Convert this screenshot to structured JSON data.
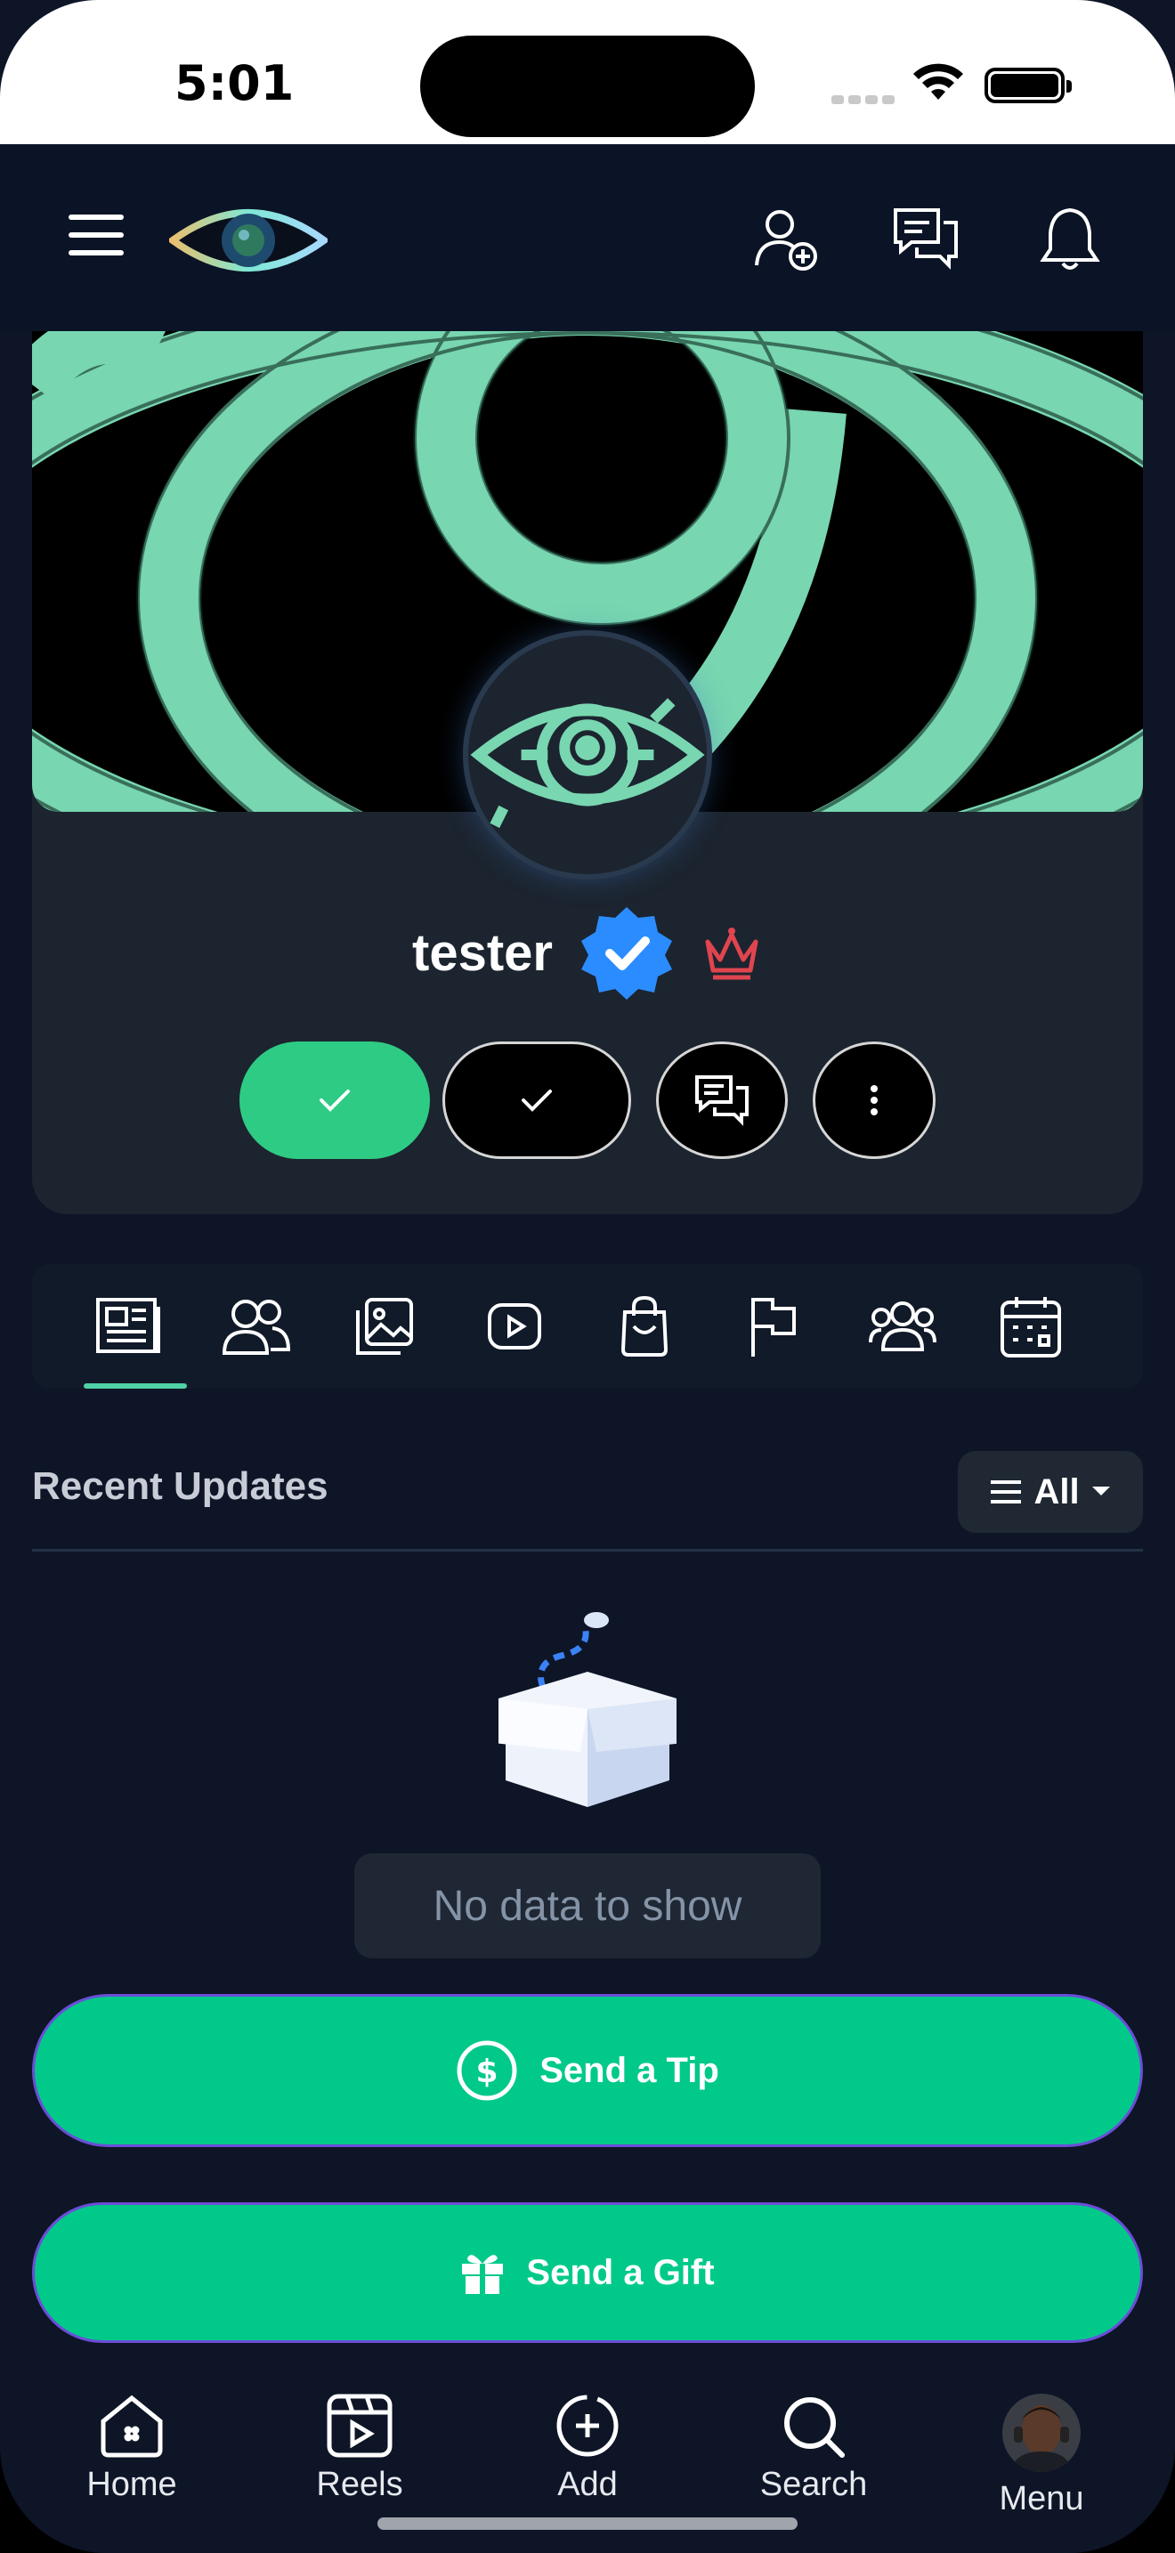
{
  "status_bar": {
    "time": "5:01"
  },
  "profile": {
    "username": "tester"
  },
  "tabs": [
    "feed-tab",
    "friends-tab",
    "photos-tab",
    "videos-tab",
    "shop-tab",
    "pages-tab",
    "groups-tab",
    "events-tab"
  ],
  "section": {
    "title": "Recent Updates",
    "filter_label": "All"
  },
  "empty_state": {
    "message": "No data to show"
  },
  "actions": {
    "tip_label": "Send a Tip",
    "gift_label": "Send a Gift"
  },
  "bottom_nav": {
    "home": "Home",
    "reels": "Reels",
    "add": "Add",
    "search": "Search",
    "menu": "Menu"
  },
  "colors": {
    "accent": "#00c98a",
    "follow": "#2ecb84",
    "verified": "#2b8cff",
    "crown": "#e0454f"
  }
}
